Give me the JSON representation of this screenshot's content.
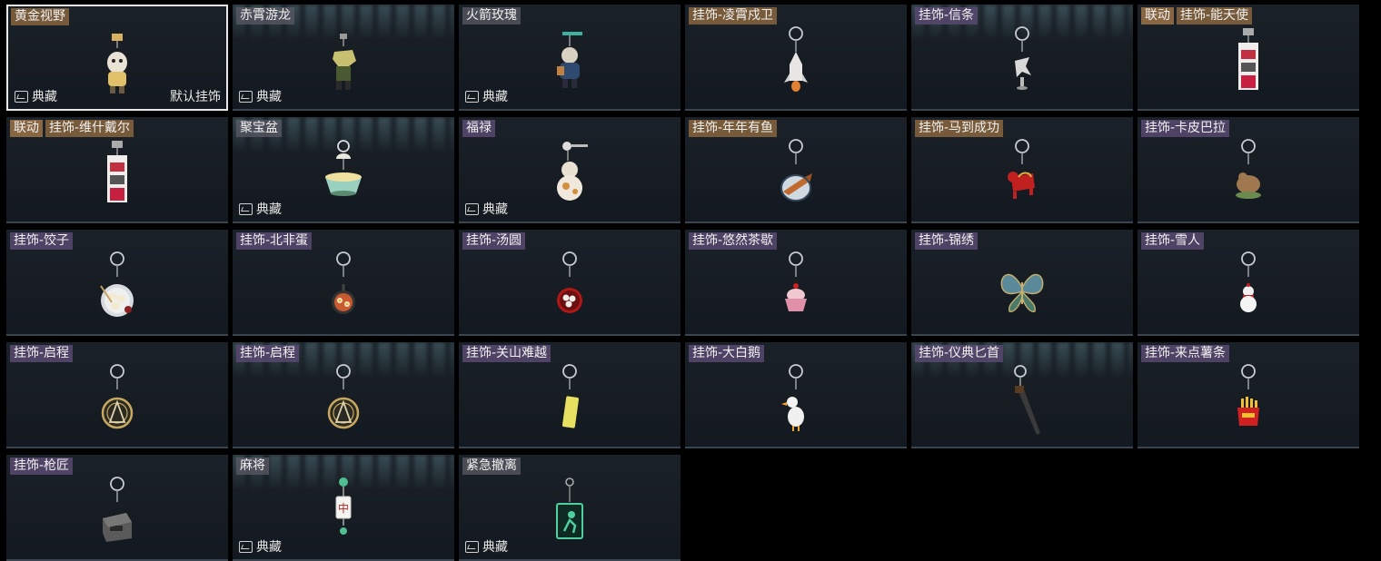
{
  "cards": [
    {
      "tags": [
        {
          "text": "黄金视野",
          "style": "gold"
        }
      ],
      "collection": "典藏",
      "default_label": "默认挂饰",
      "icon": "golden-figure-charm-icon",
      "light": false,
      "selected": true
    },
    {
      "tags": [
        {
          "text": "赤霄游龙",
          "style": "plain"
        }
      ],
      "collection": "典藏",
      "icon": "dragon-figure-charm-icon",
      "light": true
    },
    {
      "tags": [
        {
          "text": "火箭玫瑰",
          "style": "plain"
        }
      ],
      "collection": "典藏",
      "icon": "rocket-rose-figure-charm-icon",
      "light": false
    },
    {
      "tags": [
        {
          "text": "挂饰-凌霄戍卫",
          "style": "gold"
        }
      ],
      "icon": "rocket-charm-icon",
      "light": false
    },
    {
      "tags": [
        {
          "text": "挂饰-信条",
          "style": "normal"
        }
      ],
      "icon": "bird-charm-icon",
      "light": true
    },
    {
      "tags": [
        {
          "text": "联动",
          "style": "collab"
        },
        {
          "text": "挂饰-能天使",
          "style": "gold"
        }
      ],
      "icon": "card-charm-icon",
      "light": false
    },
    {
      "tags": [
        {
          "text": "联动",
          "style": "collab"
        },
        {
          "text": "挂饰-维什戴尔",
          "style": "gold"
        }
      ],
      "icon": "card-charm-icon",
      "light": false
    },
    {
      "tags": [
        {
          "text": "聚宝盆",
          "style": "plain"
        }
      ],
      "collection": "典藏",
      "icon": "treasure-bowl-charm-icon",
      "light": true
    },
    {
      "tags": [
        {
          "text": "福禄",
          "style": "normal"
        }
      ],
      "collection": "典藏",
      "icon": "gourd-charm-icon",
      "light": false
    },
    {
      "tags": [
        {
          "text": "挂饰-年年有鱼",
          "style": "gold"
        }
      ],
      "icon": "fish-charm-icon",
      "light": false
    },
    {
      "tags": [
        {
          "text": "挂饰-马到成功",
          "style": "gold"
        }
      ],
      "icon": "horse-charm-icon",
      "light": false
    },
    {
      "tags": [
        {
          "text": "挂饰-卡皮巴拉",
          "style": "normal"
        }
      ],
      "icon": "capybara-charm-icon",
      "light": false
    },
    {
      "tags": [
        {
          "text": "挂饰-饺子",
          "style": "normal"
        }
      ],
      "icon": "dumpling-plate-charm-icon",
      "light": false
    },
    {
      "tags": [
        {
          "text": "挂饰-北非蛋",
          "style": "normal"
        }
      ],
      "icon": "shakshuka-pan-charm-icon",
      "light": false
    },
    {
      "tags": [
        {
          "text": "挂饰-汤圆",
          "style": "normal"
        }
      ],
      "icon": "tangyuan-bowl-charm-icon",
      "light": false
    },
    {
      "tags": [
        {
          "text": "挂饰-悠然茶歇",
          "style": "normal"
        }
      ],
      "icon": "cupcake-charm-icon",
      "light": false
    },
    {
      "tags": [
        {
          "text": "挂饰-锦绣",
          "style": "normal"
        }
      ],
      "icon": "butterfly-charm-icon",
      "light": false
    },
    {
      "tags": [
        {
          "text": "挂饰-雪人",
          "style": "normal"
        }
      ],
      "icon": "snowman-charm-icon",
      "light": false
    },
    {
      "tags": [
        {
          "text": "挂饰-启程",
          "style": "normal"
        }
      ],
      "icon": "compass-medal-charm-icon",
      "light": false
    },
    {
      "tags": [
        {
          "text": "挂饰-启程",
          "style": "normal"
        }
      ],
      "icon": "compass-medal-charm-icon",
      "light": true
    },
    {
      "tags": [
        {
          "text": "挂饰-关山难越",
          "style": "normal"
        }
      ],
      "icon": "battery-charm-icon",
      "light": false
    },
    {
      "tags": [
        {
          "text": "挂饰-大白鹅",
          "style": "normal"
        }
      ],
      "icon": "goose-charm-icon",
      "light": false
    },
    {
      "tags": [
        {
          "text": "挂饰-仪典匕首",
          "style": "normal"
        }
      ],
      "icon": "dagger-charm-icon",
      "light": true
    },
    {
      "tags": [
        {
          "text": "挂饰-来点薯条",
          "style": "normal"
        }
      ],
      "icon": "fries-charm-icon",
      "light": false
    },
    {
      "tags": [
        {
          "text": "挂饰-枪匠",
          "style": "normal"
        }
      ],
      "icon": "gunsmith-box-charm-icon",
      "light": false
    },
    {
      "tags": [
        {
          "text": "麻将",
          "style": "plain"
        }
      ],
      "collection": "典藏",
      "icon": "mahjong-tile-charm-icon",
      "light": true
    },
    {
      "tags": [
        {
          "text": "紧急撤离",
          "style": "plain"
        }
      ],
      "collection": "典藏",
      "icon": "exit-sign-charm-icon",
      "light": false
    }
  ]
}
